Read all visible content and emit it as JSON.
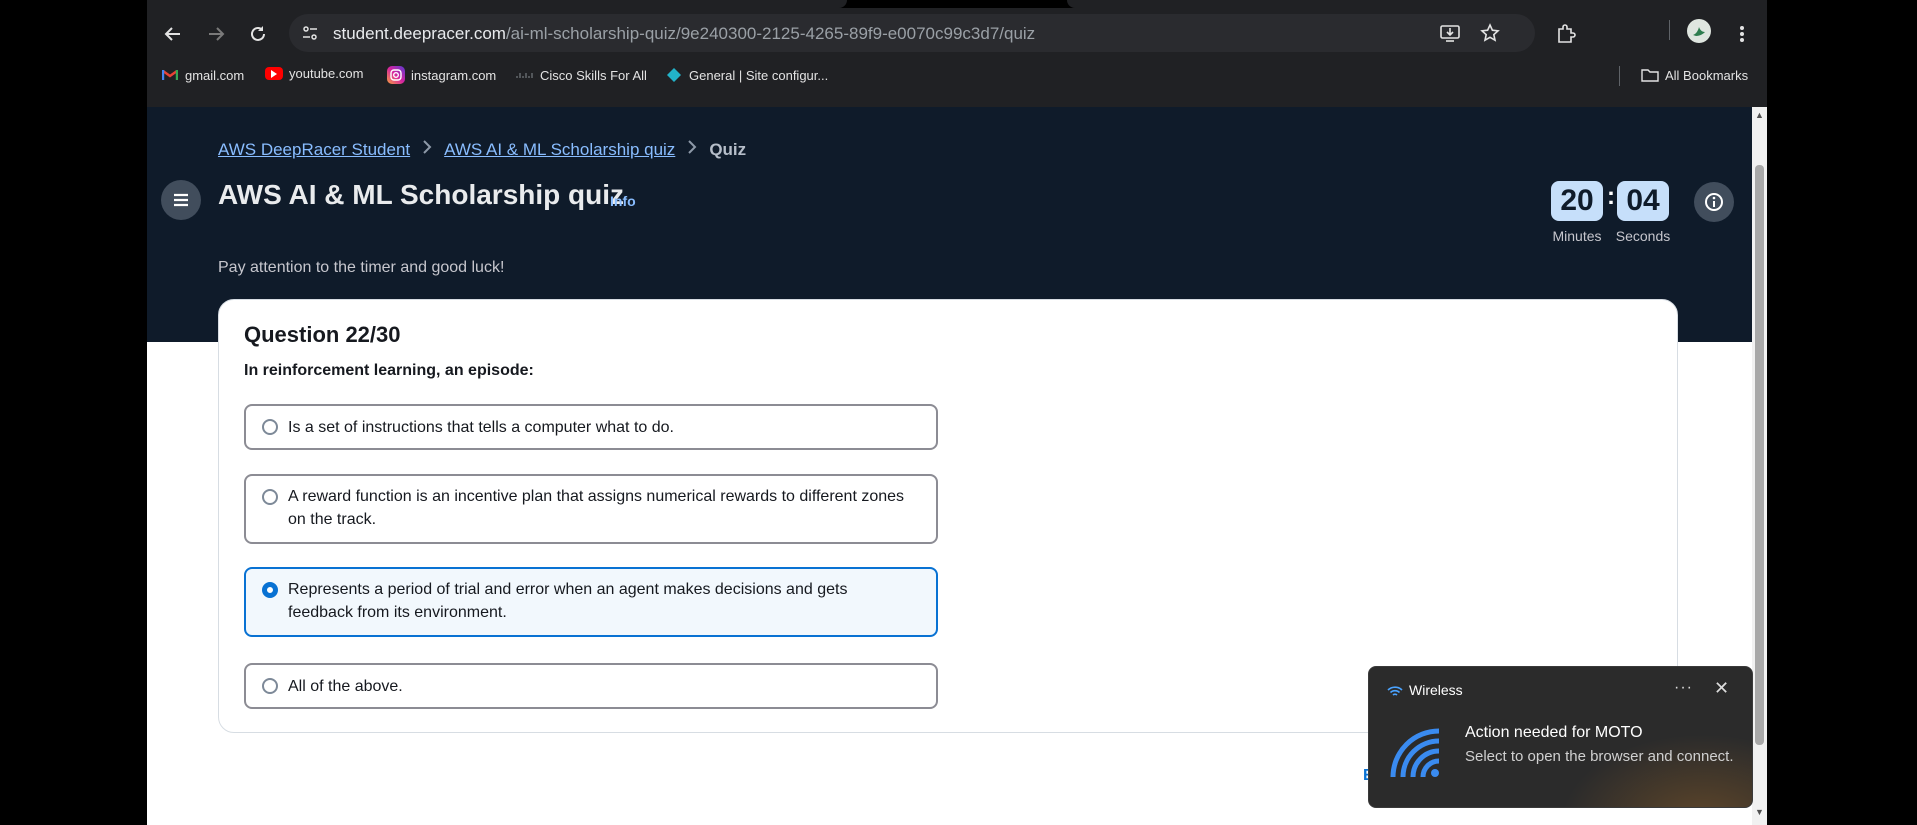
{
  "browser": {
    "url_host": "student.deepracer.com",
    "url_path": "/ai-ml-scholarship-quiz/9e240300-2125-4265-89f9-e0070c99c3d7/quiz",
    "bookmarks": [
      {
        "label": "gmail.com",
        "icon": "gmail-icon"
      },
      {
        "label": "youtube.com",
        "icon": "youtube-icon"
      },
      {
        "label": "instagram.com",
        "icon": "instagram-icon"
      },
      {
        "label": "Cisco Skills For All",
        "icon": "cisco-icon"
      },
      {
        "label": "General | Site configur...",
        "icon": "diamond-icon"
      }
    ],
    "all_bookmarks_label": "All Bookmarks"
  },
  "breadcrumbs": [
    {
      "label": "AWS DeepRacer Student"
    },
    {
      "label": "AWS AI & ML Scholarship quiz"
    }
  ],
  "breadcrumb_current": "Quiz",
  "page": {
    "title": "AWS AI & ML Scholarship quiz",
    "info_label": "Info",
    "subtitle": "Pay attention to the timer and good luck!"
  },
  "timer": {
    "minutes": "20",
    "seconds": "04",
    "separator": ":",
    "minutes_label": "Minutes",
    "seconds_label": "Seconds"
  },
  "question": {
    "number_label": "Question 22/30",
    "text": "In reinforcement learning, an episode:",
    "options": [
      {
        "label": "Is a set of instructions that tells a computer what to do.",
        "selected": false
      },
      {
        "label": "A reward function is an incentive plan that assigns numerical rewards to different zones on the track.",
        "selected": false
      },
      {
        "label": "Represents a period of trial and error when an agent makes decisions and gets feedback from its environment.",
        "selected": true
      },
      {
        "label": "All of the above.",
        "selected": false
      }
    ]
  },
  "footer_partial_text": "E",
  "notification": {
    "app": "Wireless",
    "more": "···",
    "close": "✕",
    "heading": "Action needed for MOTO",
    "body": "Select to open the browser and connect."
  },
  "colors": {
    "header_bg": "#0f1b2a",
    "link": "#89bdff",
    "accent": "#0972d3",
    "timer_box": "#c6dffa"
  }
}
